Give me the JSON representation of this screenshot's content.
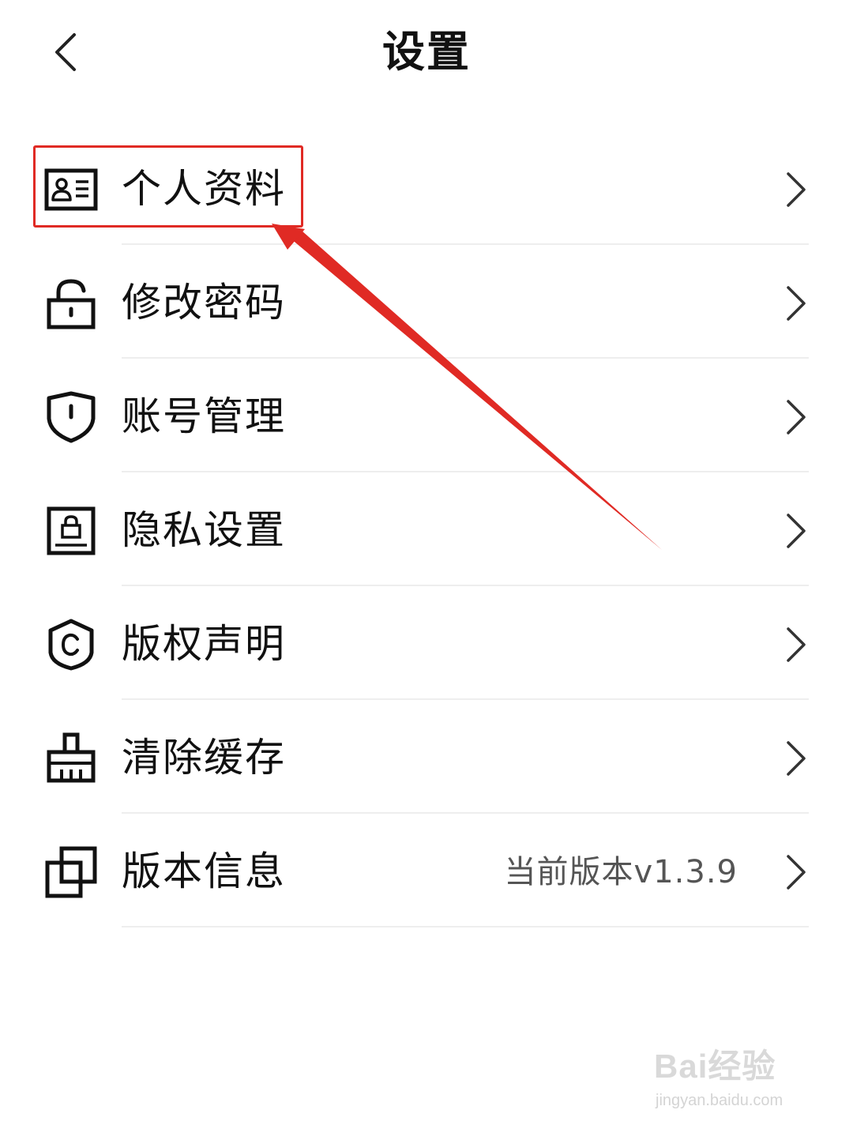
{
  "header": {
    "title": "设置",
    "back_icon": "chevron-left-icon"
  },
  "menu": {
    "items": [
      {
        "label": "个人资料",
        "icon": "id-card-icon",
        "value": ""
      },
      {
        "label": "修改密码",
        "icon": "unlocked-padlock-icon",
        "value": ""
      },
      {
        "label": "账号管理",
        "icon": "shield-icon",
        "value": ""
      },
      {
        "label": "隐私设置",
        "icon": "privacy-lock-screen-icon",
        "value": ""
      },
      {
        "label": "版权声明",
        "icon": "copyright-shield-icon",
        "value": ""
      },
      {
        "label": "清除缓存",
        "icon": "broom-icon",
        "value": ""
      },
      {
        "label": "版本信息",
        "icon": "overlapping-squares-icon",
        "value": "当前版本v1.3.9"
      }
    ]
  },
  "annotation": {
    "highlight_color": "#e02a24"
  },
  "watermark": {
    "logo_text": "Bai经验",
    "url": "jingyan.baidu.com"
  }
}
